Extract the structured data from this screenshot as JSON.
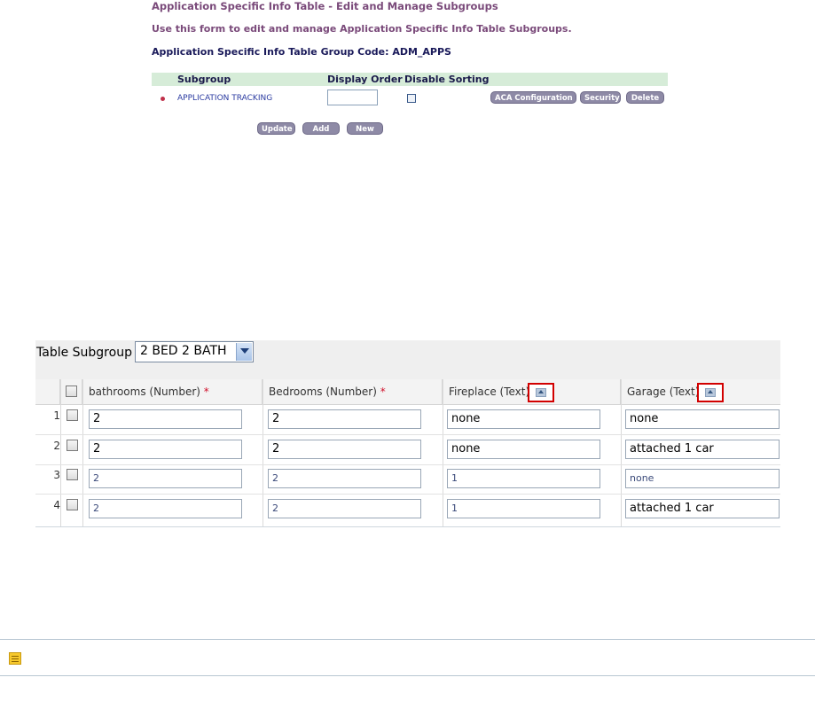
{
  "page": {
    "title": "Application Specific Info Table - Edit and Manage Subgroups",
    "description": "Use this form to edit and manage Application Specific Info Table Subgroups.",
    "group_code_text": "Application Specific Info Table Group Code: ADM_APPS"
  },
  "subgroups": {
    "headers": {
      "subgroup": "Subgroup",
      "display_order": "Display Order",
      "disable_sorting": "Disable Sorting"
    },
    "rows": [
      {
        "name": "APPLICATION TRACKING",
        "display_order": "",
        "disable_sorting": false
      }
    ],
    "row_buttons": {
      "aca": "ACA Configuration",
      "security": "Security",
      "delete": "Delete"
    },
    "actions": {
      "update": "Update",
      "add": "Add",
      "new": "New"
    }
  },
  "table_subgroup": {
    "label": "Table Subgroup",
    "selected": "2 BED 2 BATH",
    "columns": [
      {
        "label": "bathrooms (Number)",
        "required": "*"
      },
      {
        "label": "Bedrooms (Number)",
        "required": "*"
      },
      {
        "label": "Fireplace (Text)"
      },
      {
        "label": "Garage (Text)"
      }
    ],
    "rows": [
      {
        "num": "1",
        "bathrooms": "2",
        "bedrooms": "2",
        "fireplace": "none",
        "garage": "none"
      },
      {
        "num": "2",
        "bathrooms": "2",
        "bedrooms": "2",
        "fireplace": "none",
        "garage": "attached 1 car"
      },
      {
        "num": "3",
        "bathrooms": "2",
        "bedrooms": "2",
        "fireplace": "1",
        "garage": "none"
      },
      {
        "num": "4",
        "bathrooms": "2",
        "bedrooms": "2",
        "fireplace": "1",
        "garage": "attached 1 car"
      }
    ]
  },
  "icons": {
    "sort": "sort-up-icon",
    "note": "note-icon"
  },
  "colors": {
    "title": "#7a4a7a",
    "header_bg": "#d6ecd8",
    "pill": "#8e8aa6",
    "highlight": "#d20000",
    "note": "#f7c92d"
  }
}
